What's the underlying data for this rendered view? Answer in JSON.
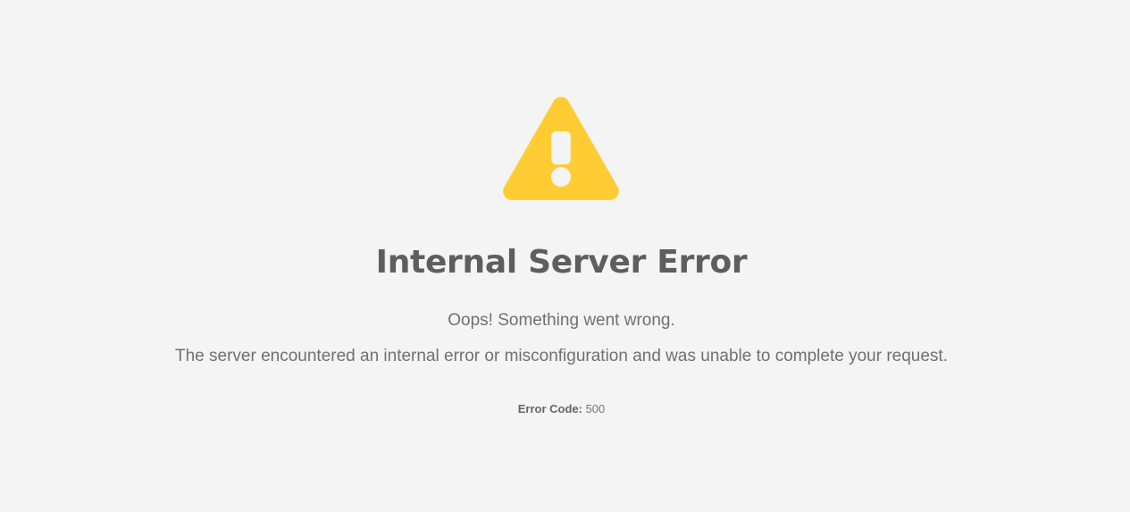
{
  "icon": {
    "name": "warning-triangle-icon",
    "color": "#ffcd33",
    "mark_color": "#f4f4f4"
  },
  "title": "Internal Server Error",
  "subtitle": "Oops! Something went wrong.",
  "description": "The server encountered an internal error or misconfiguration and was unable to complete your request.",
  "error_code": {
    "label": "Error Code:",
    "value": "500"
  },
  "colors": {
    "background": "#f4f4f4",
    "title": "#5e5e5e",
    "body_text": "#707070"
  }
}
